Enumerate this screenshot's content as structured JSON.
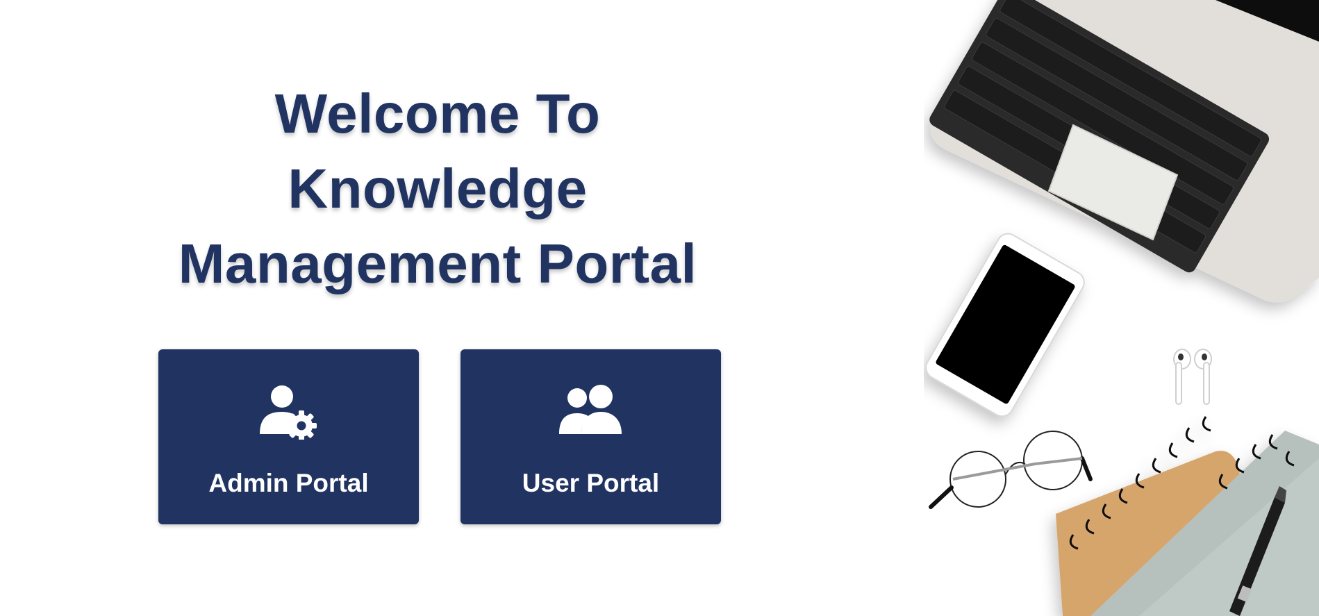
{
  "heading": {
    "line1": "Welcome To",
    "line2": "Knowledge",
    "line3": "Management Portal"
  },
  "portals": [
    {
      "label": "Admin Portal",
      "icon": "user-gear-icon"
    },
    {
      "label": "User Portal",
      "icon": "users-icon"
    }
  ],
  "decor": {
    "items": [
      "laptop-image",
      "smartphone-image",
      "earbuds-image",
      "glasses-image",
      "notebook-image",
      "pen-image"
    ]
  },
  "colors": {
    "brand": "#213461",
    "background": "#ffffff",
    "tile_text": "#ffffff"
  }
}
